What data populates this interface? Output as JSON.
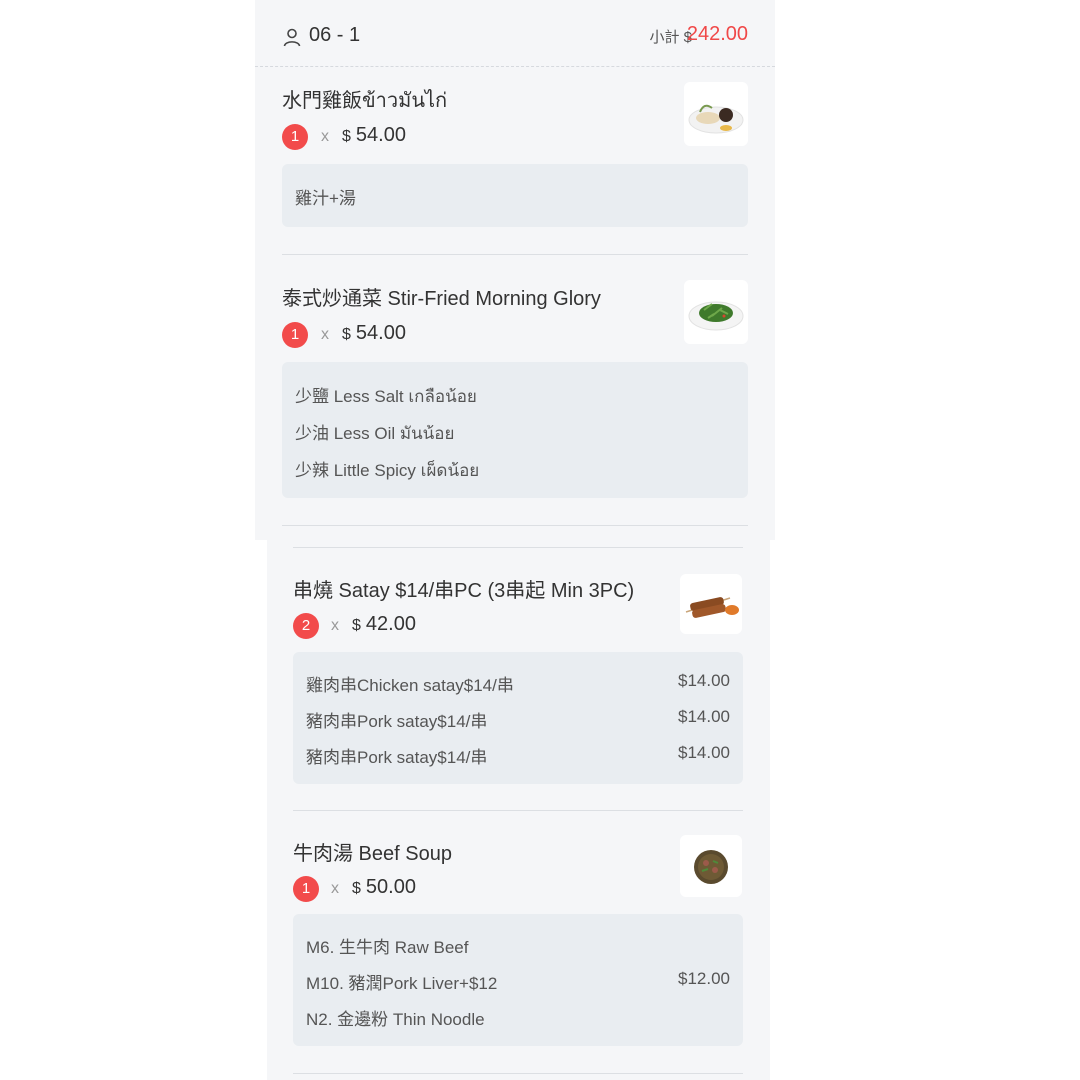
{
  "header": {
    "table_no": "06 - 1",
    "subtotal_label": "小計 $",
    "subtotal_value": "242.00"
  },
  "items": [
    {
      "name": "水門雞飯ข้าวมันไก่",
      "qty": "1",
      "times": "x",
      "currency": "$",
      "price": "54.00",
      "thumb_icon": "chicken-rice-icon",
      "notes": [
        {
          "label": "雞汁+湯",
          "price": ""
        }
      ]
    },
    {
      "name": "泰式炒通菜 Stir-Fried Morning Glory",
      "qty": "1",
      "times": "x",
      "currency": "$",
      "price": "54.00",
      "thumb_icon": "morning-glory-icon",
      "notes": [
        {
          "label": "少鹽 Less Salt เกลือน้อย",
          "price": ""
        },
        {
          "label": "少油 Less Oil มันน้อย",
          "price": ""
        },
        {
          "label": "少辣 Little Spicy เผ็ดน้อย",
          "price": ""
        }
      ]
    },
    {
      "name": "串燒 Satay $14/串PC (3串起 Min 3PC)",
      "qty": "2",
      "times": "x",
      "currency": "$",
      "price": "42.00",
      "thumb_icon": "satay-icon",
      "notes": [
        {
          "label": "雞肉串Chicken satay$14/串",
          "price": "$14.00"
        },
        {
          "label": "豬肉串Pork satay$14/串",
          "price": "$14.00"
        },
        {
          "label": "豬肉串Pork satay$14/串",
          "price": "$14.00"
        }
      ]
    },
    {
      "name": "牛肉湯 Beef Soup",
      "qty": "1",
      "times": "x",
      "currency": "$",
      "price": "50.00",
      "thumb_icon": "beef-soup-icon",
      "notes": [
        {
          "label": "M6. 生牛肉 Raw Beef",
          "price": ""
        },
        {
          "label": "M10. 豬潤Pork Liver+$12",
          "price": "$12.00"
        },
        {
          "label": "N2. 金邊粉 Thin Noodle",
          "price": ""
        }
      ]
    }
  ],
  "colors": {
    "accent_red": "#f24b4b",
    "subtotal_red": "#f04848",
    "panel_bg": "#f5f6f8",
    "note_bg": "#e9edf1"
  }
}
